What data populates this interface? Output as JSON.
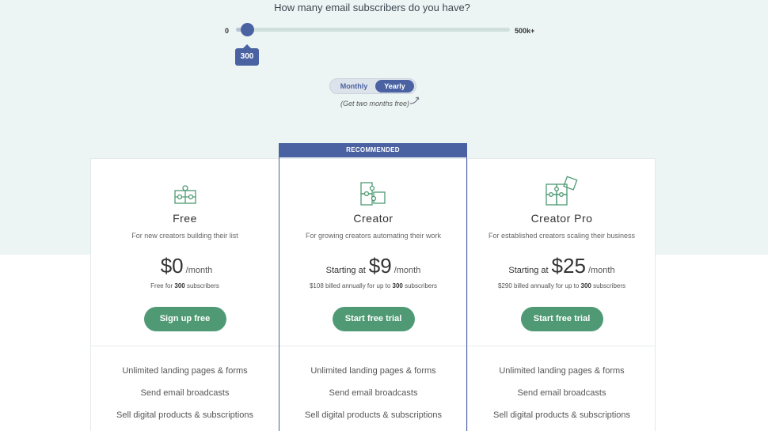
{
  "question": "How many email subscribers do you have?",
  "slider": {
    "min_label": "0",
    "max_label": "500k+",
    "value": "300",
    "fill_fraction": 0.02
  },
  "billing_toggle": {
    "monthly": "Monthly",
    "yearly": "Yearly",
    "selected": "Yearly",
    "note": "(Get two months free)"
  },
  "recommended_badge": "RECOMMENDED",
  "colors": {
    "accent": "#4a62a2",
    "cta": "#4f9a74",
    "icon": "#4f9a74",
    "top_bg": "#edf5f4"
  },
  "plans": [
    {
      "name": "Free",
      "description": "For new creators building their list",
      "price_prefix": "",
      "price": "$0",
      "period": "/month",
      "billing_pre": "Free for ",
      "billing_count": "300",
      "billing_post": " subscribers",
      "cta": "Sign up free",
      "icon": "puzzle-icon",
      "features": [
        "Unlimited landing pages & forms",
        "Send email broadcasts",
        "Sell digital products & subscriptions"
      ]
    },
    {
      "name": "Creator",
      "description": "For growing creators automating their work",
      "price_prefix": "Starting at",
      "price": "$9",
      "period": "/month",
      "billing_pre": "$108 billed annually for up to ",
      "billing_count": "300",
      "billing_post": " subscribers",
      "cta": "Start free trial",
      "icon": "puzzle-pieces-icon",
      "features": [
        "Unlimited landing pages & forms",
        "Send email broadcasts",
        "Sell digital products & subscriptions"
      ]
    },
    {
      "name": "Creator Pro",
      "description": "For established creators scaling their business",
      "price_prefix": "Starting at",
      "price": "$25",
      "period": "/month",
      "billing_pre": "$290 billed annually for up to ",
      "billing_count": "300",
      "billing_post": " subscribers",
      "cta": "Start free trial",
      "icon": "puzzle-stack-icon",
      "features": [
        "Unlimited landing pages & forms",
        "Send email broadcasts",
        "Sell digital products & subscriptions"
      ]
    }
  ]
}
